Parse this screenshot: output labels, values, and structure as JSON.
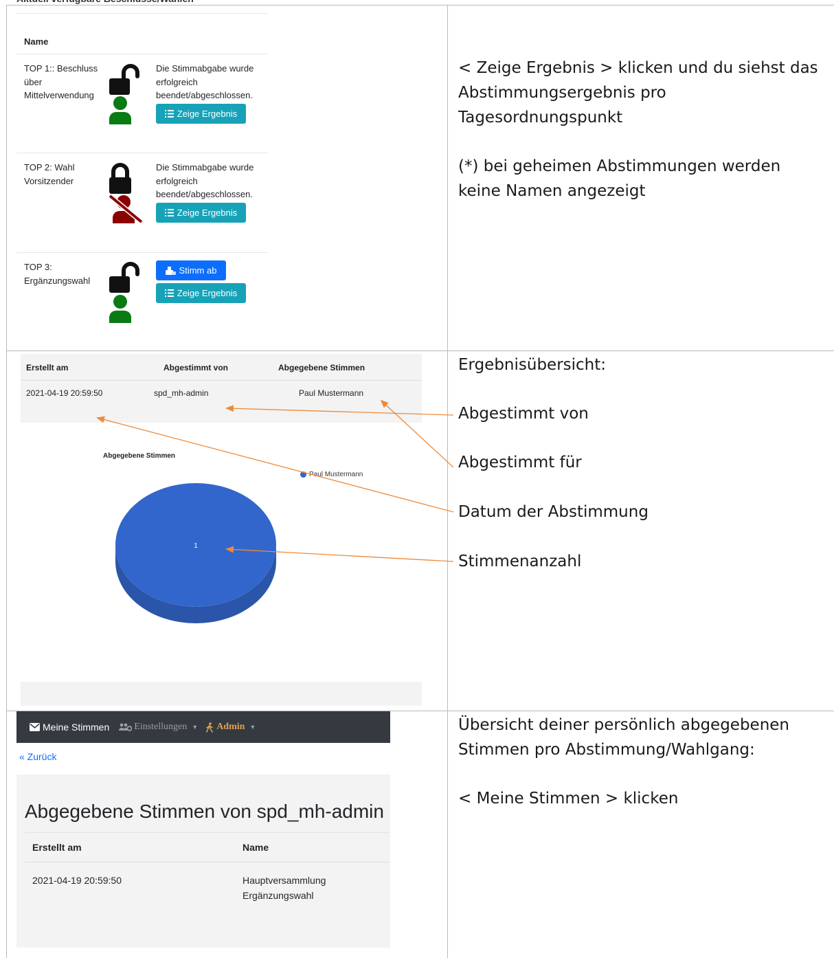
{
  "panel1": {
    "cut_heading": "Aktuell verfügbare Beschlüsse/Wahlen",
    "column_name": "Name",
    "items": [
      {
        "title": "TOP 1:: Beschluss über Mittelverwendung",
        "status": "Die Stimmabgabe wurde erfolgreich beendet/abgeschlossen.",
        "lock": "lock-open-icon",
        "user": "user-icon",
        "result_button": "Zeige Ergebnis"
      },
      {
        "title": "TOP 2: Wahl Vorsitzender",
        "status": "Die Stimmabgabe wurde erfolgreich beendet/abgeschlossen.",
        "lock": "lock-closed-icon",
        "user": "user-slash-icon",
        "result_button": "Zeige Ergebnis"
      },
      {
        "title": "TOP 3: Ergänzungswahl",
        "vote_button": "Stimm ab",
        "lock": "lock-open-icon",
        "user": "user-icon",
        "result_button": "Zeige Ergebnis"
      }
    ]
  },
  "right": {
    "r1_line1": "< Zeige Ergebnis > klicken und du siehst das",
    "r1_line2": "Abstimmungsergebnis pro",
    "r1_line3": "Tagesordnungspunkt",
    "r1_line4": "(*) bei geheimen Abstimmungen werden",
    "r1_line5": "keine Namen angezeigt",
    "r2_title": "Ergebnisübersicht:",
    "r2_a": "Abgestimmt von",
    "r2_b": "Abgestimmt für",
    "r2_c": "Datum der Abstimmung",
    "r2_d": "Stimmenanzahl",
    "r3_line1": "Übersicht deiner persönlich abgegebenen",
    "r3_line2": "Stimmen pro Abstimmung/Wahlgang:",
    "r3_line3": "< Meine Stimmen > klicken"
  },
  "panel2": {
    "headers": [
      "Erstellt am",
      "Abgestimmt von",
      "Abgegebene Stimmen"
    ],
    "row": [
      "2021-04-19 20:59:50",
      "spd_mh-admin",
      "Paul Mustermann"
    ]
  },
  "chart_data": {
    "type": "pie",
    "title": "Abgegebene Stimmen",
    "categories": [
      "Paul Mustermann"
    ],
    "values": [
      1
    ],
    "legend": "right",
    "colors": [
      "#3366cc"
    ]
  },
  "panel3": {
    "nav_mail": "Meine Stimmen",
    "nav_settings": "Einstellungen",
    "nav_admin": "Admin",
    "back": "« Zurück",
    "title": "Abgegebene Stimmen von spd_mh-admin",
    "headers": [
      "Erstellt am",
      "Name"
    ],
    "row_date": "2021-04-19 20:59:50",
    "row_name_1": "Hauptversammlung",
    "row_name_2": "Ergänzungswahl"
  },
  "colors": {
    "teal": "#17a2b8",
    "blue": "#0d6efd",
    "green": "#0a7a13",
    "darkred": "#8b0000",
    "orange": "#ee8a3a",
    "navbar": "#343a40"
  }
}
